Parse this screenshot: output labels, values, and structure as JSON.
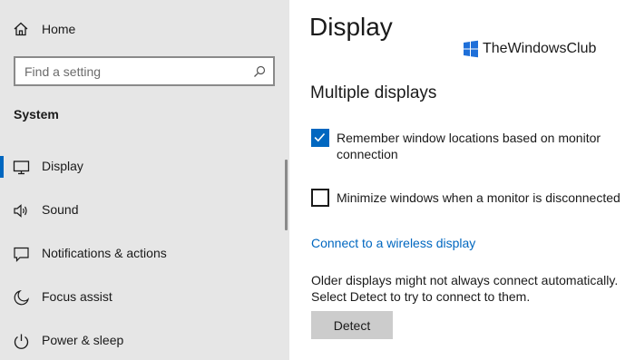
{
  "sidebar": {
    "home_label": "Home",
    "search_placeholder": "Find a setting",
    "section_header": "System",
    "items": [
      {
        "label": "Display",
        "icon": "monitor-icon",
        "active": true
      },
      {
        "label": "Sound",
        "icon": "speaker-icon",
        "active": false
      },
      {
        "label": "Notifications & actions",
        "icon": "notification-icon",
        "active": false
      },
      {
        "label": "Focus assist",
        "icon": "moon-icon",
        "active": false
      },
      {
        "label": "Power & sleep",
        "icon": "power-icon",
        "active": false
      }
    ]
  },
  "main": {
    "title": "Display",
    "section_title": "Multiple displays",
    "remember_label": "Remember window locations based on monitor connection",
    "remember_line1": "Remember window locations based on monitor",
    "remember_line2": "connection",
    "remember_checked": true,
    "minimize_label": "Minimize windows when a monitor is disconnected",
    "minimize_checked": false,
    "wireless_link": "Connect to a wireless display",
    "older_line1": "Older displays might not always connect automatically.",
    "older_line2": "Select Detect to try to connect to them.",
    "detect_button": "Detect"
  },
  "watermark": {
    "text": "TheWindowsClub"
  },
  "colors": {
    "accent": "#0067c0",
    "sidebar_bg": "#e6e6e6",
    "button_bg": "#cccccc"
  }
}
